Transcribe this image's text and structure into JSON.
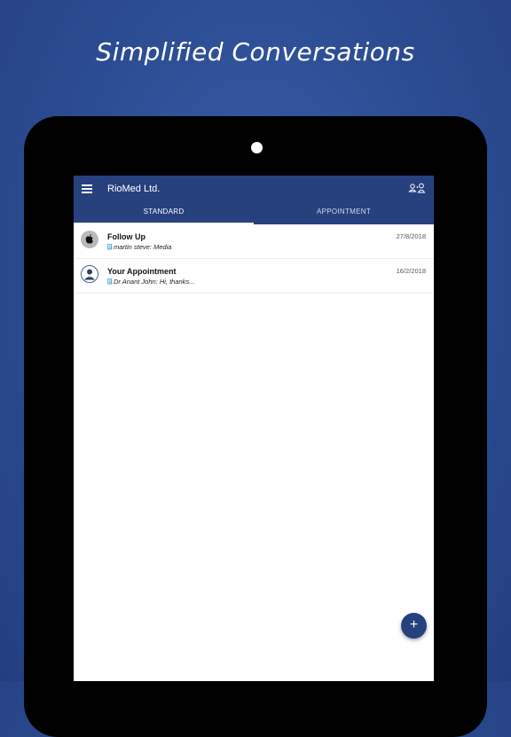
{
  "headline": "Simplified Conversations",
  "app": {
    "title": "RioMed Ltd.",
    "tabs": [
      {
        "label": "STANDARD",
        "active": true
      },
      {
        "label": "APPOINTMENT",
        "active": false
      }
    ]
  },
  "conversations": [
    {
      "title": "Follow Up",
      "preview": "martin steve: Media",
      "date": "27/8/2018",
      "avatar_icon": "apple-icon"
    },
    {
      "title": "Your Appointment",
      "preview": "Dr Anant John: Hi, thanks...",
      "date": "16/2/2018",
      "avatar_icon": "person-icon"
    }
  ],
  "fab": {
    "label": "+"
  },
  "colors": {
    "appbar": "#27417f",
    "background": "#2e4f96",
    "fab": "#27417f",
    "message_icon": "#4aa3df"
  }
}
